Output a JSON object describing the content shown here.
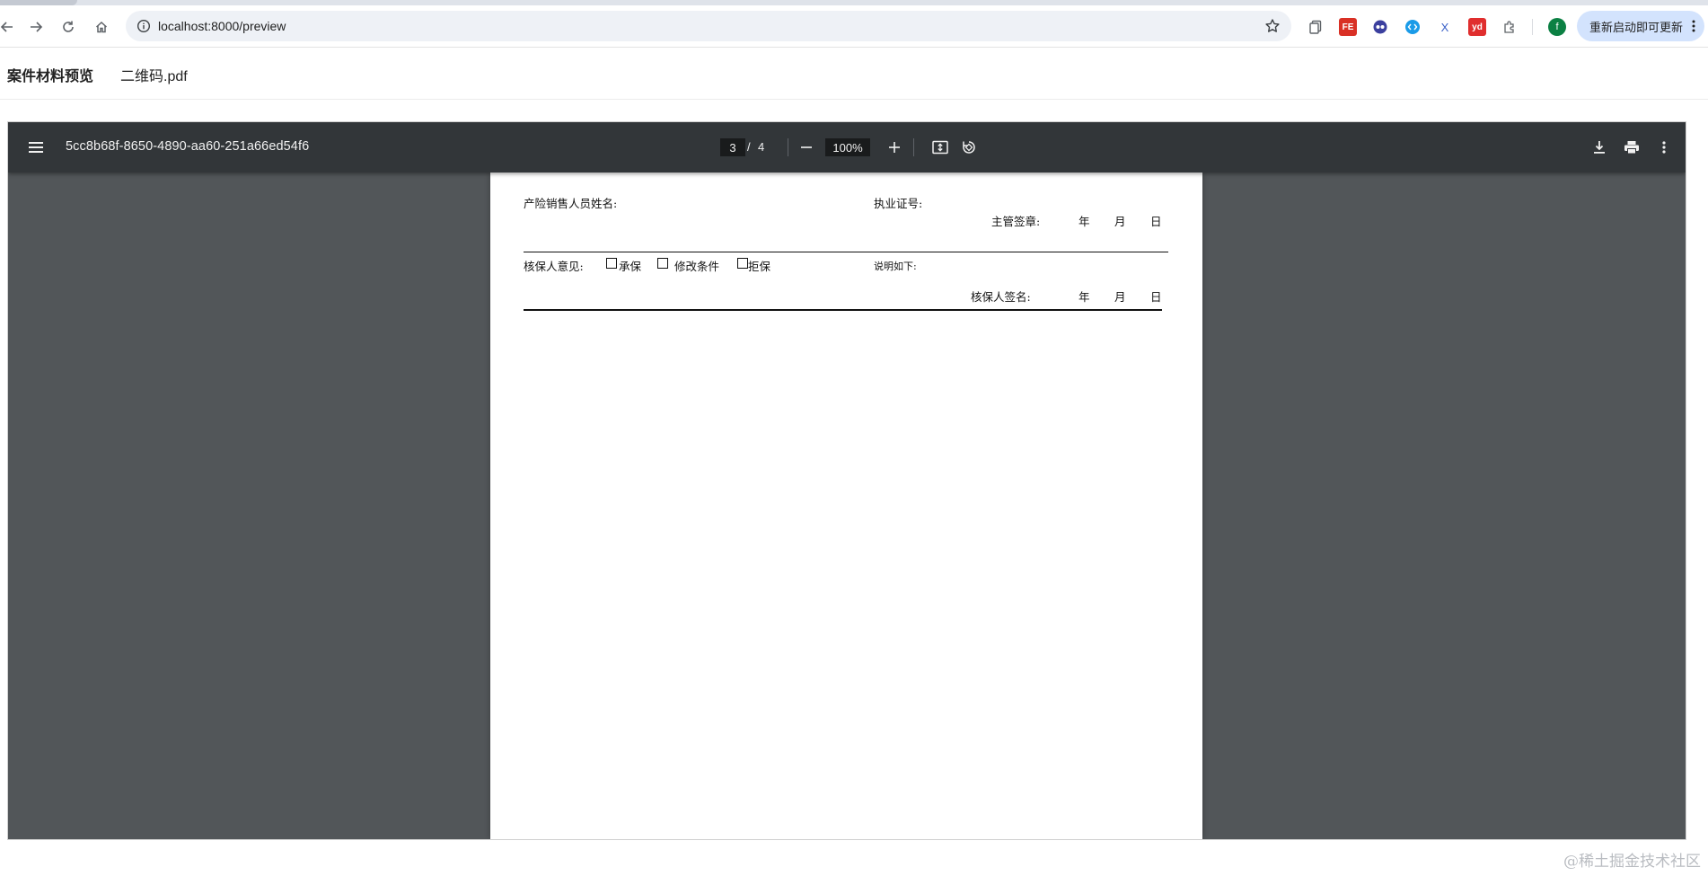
{
  "browser": {
    "url": "localhost:8000/preview",
    "update_label": "重新启动即可更新",
    "profile_initial": "f",
    "extensions": [
      "copy-icon",
      "fe-icon",
      "eyes-icon",
      "code-icon",
      "x-icon",
      "yd-icon",
      "puzzle-icon"
    ],
    "extension_texts": {
      "fe": "FE",
      "x": "X",
      "yd": "yd"
    }
  },
  "header": {
    "title": "案件材料预览",
    "file_name": "二维码.pdf"
  },
  "viewer": {
    "doc_title": "5cc8b68f-8650-4890-aa60-251a66ed54f6",
    "current_page": "3",
    "separator": "/",
    "total_pages": "4",
    "zoom": "100%"
  },
  "page": {
    "salesperson_label": "产险销售人员姓名:",
    "license_label": "执业证号:",
    "supervisor_sign_label": "主管签章:",
    "year": "年",
    "month": "月",
    "day": "日",
    "underwriter_opinion_label": "核保人意见:",
    "option_accept": "承保",
    "option_modify": "修改条件",
    "option_reject": "拒保",
    "explanation_label": "说明如下:",
    "underwriter_sign_label": "核保人签名:"
  },
  "watermark": "@稀土掘金技术社区",
  "colors": {
    "viewer_toolbar": "#323639",
    "viewer_background": "#525659",
    "update_button": "#d3e3fd",
    "profile": "#0b8043"
  }
}
